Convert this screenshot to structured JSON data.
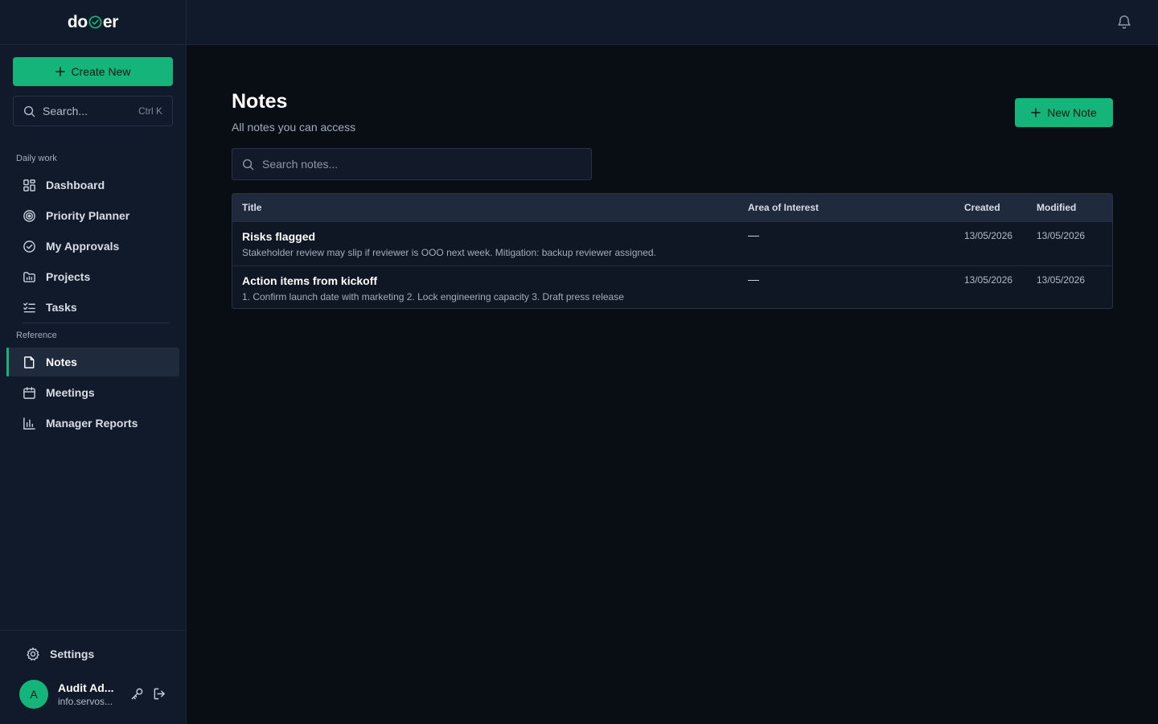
{
  "brand": {
    "logo_left": "do",
    "logo_right": "er",
    "accent": "#14b47a"
  },
  "sidebar": {
    "create_label": "Create New",
    "search_placeholder": "Search...",
    "search_shortcut": "Ctrl K",
    "section_daily": "Daily work",
    "section_reference": "Reference",
    "daily_items": [
      {
        "label": "Dashboard",
        "icon": "grid-icon"
      },
      {
        "label": "Priority Planner",
        "icon": "target-icon"
      },
      {
        "label": "My Approvals",
        "icon": "check-circle-icon"
      },
      {
        "label": "Projects",
        "icon": "folder-chart-icon"
      },
      {
        "label": "Tasks",
        "icon": "list-check-icon"
      }
    ],
    "reference_items": [
      {
        "label": "Notes",
        "icon": "note-icon",
        "active": true
      },
      {
        "label": "Meetings",
        "icon": "calendar-icon"
      },
      {
        "label": "Manager Reports",
        "icon": "bar-chart-icon"
      }
    ],
    "settings_label": "Settings",
    "user": {
      "initial": "A",
      "name": "Audit Ad...",
      "email": "info.servos..."
    }
  },
  "main": {
    "title": "Notes",
    "subtitle": "All notes you can access",
    "new_note_label": "New Note",
    "search_placeholder": "Search notes...",
    "table": {
      "headers": {
        "title": "Title",
        "area": "Area of Interest",
        "created": "Created",
        "modified": "Modified"
      },
      "rows": [
        {
          "title": "Risks flagged",
          "description": "Stakeholder review may slip if reviewer is OOO next week. Mitigation: backup reviewer assigned.",
          "area": "—",
          "created": "13/05/2026",
          "modified": "13/05/2026"
        },
        {
          "title": "Action items from kickoff",
          "description": "1. Confirm launch date with marketing 2. Lock engineering capacity 3. Draft press release",
          "area": "—",
          "created": "13/05/2026",
          "modified": "13/05/2026"
        }
      ]
    }
  }
}
